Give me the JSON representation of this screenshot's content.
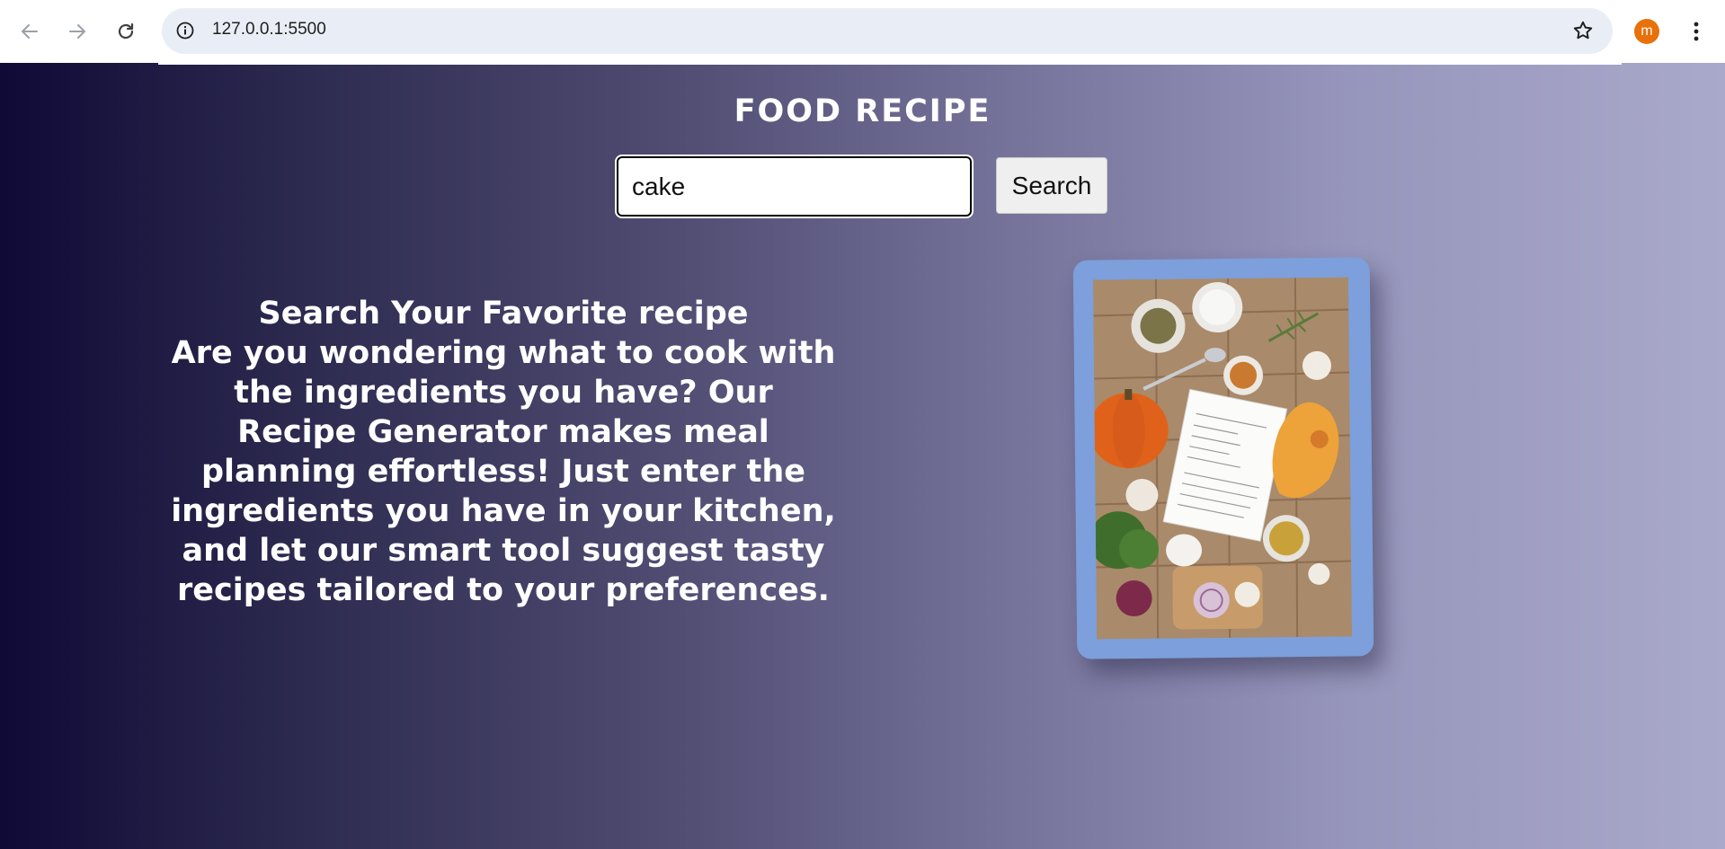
{
  "browser": {
    "url": "127.0.0.1:5500",
    "profile_initial": "m",
    "profile_color": "#e8710a",
    "icons": [
      "back-arrow-icon",
      "forward-arrow-icon",
      "reload-icon",
      "site-info-icon",
      "bookmark-star-icon",
      "kebab-menu-icon"
    ]
  },
  "page": {
    "title": "FOOD RECIPE",
    "search": {
      "value": "cake",
      "button_label": "Search"
    },
    "intro": {
      "heading": "Search Your Favorite recipe",
      "body": "Are you wondering what to cook with the ingredients you have? Our Recipe Generator makes meal planning effortless! Just enter the ingredients you have in your kitchen, and let our smart tool suggest tasty recipes tailored to your preferences."
    },
    "card_color": "#7d9fdb"
  }
}
